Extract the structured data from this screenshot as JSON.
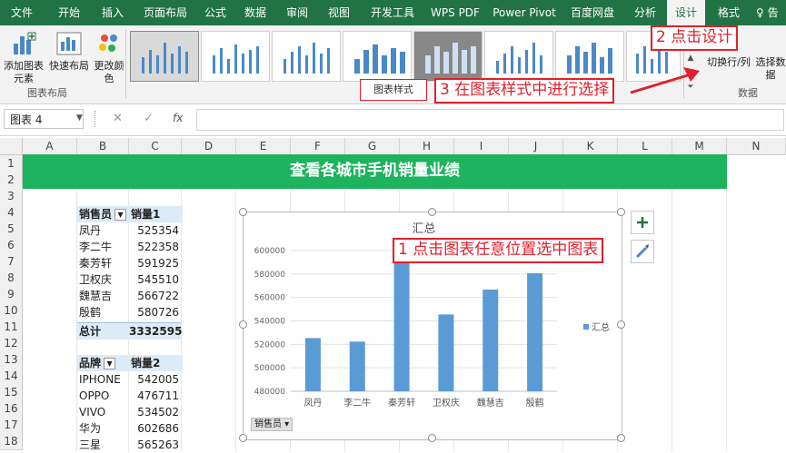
{
  "ribbon": {
    "tabs": [
      "文件",
      "开始",
      "插入",
      "页面布局",
      "公式",
      "数据",
      "审阅",
      "视图",
      "开发工具",
      "WPS PDF",
      "Power Pivot",
      "百度网盘",
      "分析",
      "设计",
      "格式",
      "♀ 告"
    ],
    "active_tab": "设计",
    "buttons": {
      "add_element": "添加图表元素",
      "quick_layout": "快速布局",
      "change_colors": "更改颜色",
      "switch_row_col": "切换行/列",
      "select_data": "选择数据"
    },
    "groups": {
      "layout": "图表布局",
      "styles": "图表样式",
      "data": "数据"
    }
  },
  "annotations": {
    "step1": "1 点击图表任意位置选中图表",
    "step2": "2 点击设计",
    "step3": "3 在图表样式中进行选择"
  },
  "formula_bar": {
    "name_box": "图表 4",
    "fx": "fx",
    "cancel": "✕",
    "confirm": "✓"
  },
  "grid": {
    "columns": [
      "A",
      "B",
      "C",
      "D",
      "E",
      "F",
      "G",
      "H",
      "I",
      "J",
      "K",
      "L",
      "M",
      "N"
    ],
    "rows": [
      "1",
      "2",
      "3",
      "4",
      "5",
      "6",
      "7",
      "8",
      "9",
      "10",
      "11",
      "12",
      "13",
      "14",
      "15",
      "16",
      "17",
      "18"
    ],
    "banner": "查看各城市手机销量业绩",
    "table1": {
      "headers": [
        "销售员",
        "销量1"
      ],
      "rows": [
        [
          "凤丹",
          "525354"
        ],
        [
          "李二牛",
          "522358"
        ],
        [
          "秦芳轩",
          "591925"
        ],
        [
          "卫权庆",
          "545510"
        ],
        [
          "魏慧吉",
          "566722"
        ],
        [
          "殷鹤",
          "580726"
        ]
      ],
      "total_label": "总计",
      "total_value": "3332595"
    },
    "table2": {
      "headers": [
        "品牌",
        "销量2"
      ],
      "rows": [
        [
          "IPHONE",
          "542005"
        ],
        [
          "OPPO",
          "476711"
        ],
        [
          "VIVO",
          "534502"
        ],
        [
          "华为",
          "602686"
        ],
        [
          "三星",
          "565263"
        ]
      ]
    }
  },
  "chart_data": {
    "type": "bar",
    "title": "汇总",
    "categories": [
      "凤丹",
      "李二牛",
      "秦芳轩",
      "卫权庆",
      "魏慧吉",
      "殷鹤"
    ],
    "series": [
      {
        "name": "汇总",
        "values": [
          525354,
          522358,
          591925,
          545510,
          566722,
          580726
        ]
      }
    ],
    "ylim": [
      480000,
      600000
    ],
    "yticks": [
      "600000",
      "580000",
      "560000",
      "540000",
      "520000",
      "500000",
      "480000"
    ],
    "field_button": "销售员",
    "legend_position": "right",
    "bar_color": "#5b9bd5"
  }
}
